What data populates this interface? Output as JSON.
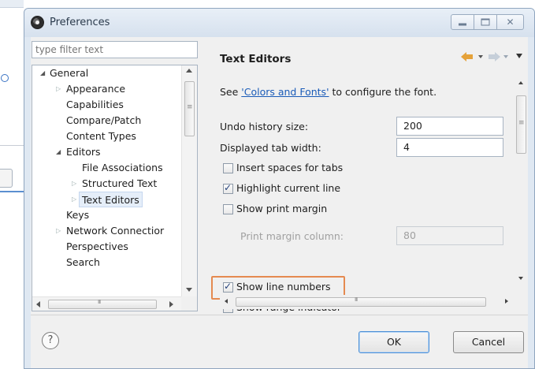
{
  "dialog": {
    "title": "Preferences"
  },
  "filter": {
    "placeholder": "type filter text"
  },
  "tree": {
    "items": [
      {
        "label": "General",
        "expanded": true
      },
      {
        "label": "Appearance",
        "expanded": false
      },
      {
        "label": "Capabilities"
      },
      {
        "label": "Compare/Patch"
      },
      {
        "label": "Content Types"
      },
      {
        "label": "Editors",
        "expanded": true
      },
      {
        "label": "File Associations"
      },
      {
        "label": "Structured Text",
        "expanded": false
      },
      {
        "label": "Text Editors",
        "expanded": false,
        "selected": true
      },
      {
        "label": "Keys"
      },
      {
        "label": "Network Connectior",
        "expanded": false
      },
      {
        "label": "Perspectives"
      },
      {
        "label": "Search"
      }
    ]
  },
  "page": {
    "title": "Text Editors",
    "intro_prefix": "See ",
    "intro_link": "'Colors and Fonts'",
    "intro_suffix": " to configure the font.",
    "undo_label": "Undo history size:",
    "undo_value": "200",
    "tab_label": "Displayed tab width:",
    "tab_value": "4",
    "checkboxes": [
      {
        "label": "Insert spaces for tabs",
        "checked": false
      },
      {
        "label": "Highlight current line",
        "checked": true
      },
      {
        "label": "Show print margin",
        "checked": false
      },
      {
        "label": "Show line numbers",
        "checked": true
      },
      {
        "label": "Show range indicator",
        "checked": true
      }
    ],
    "print_margin_label": "Print margin column:",
    "print_margin_value": "80"
  },
  "buttons": {
    "help": "?",
    "ok": "OK",
    "cancel": "Cancel"
  },
  "colors": {
    "highlight_border": "#e58a50",
    "link": "#1a5bb8",
    "nav_arrow": "#e5a23a"
  }
}
